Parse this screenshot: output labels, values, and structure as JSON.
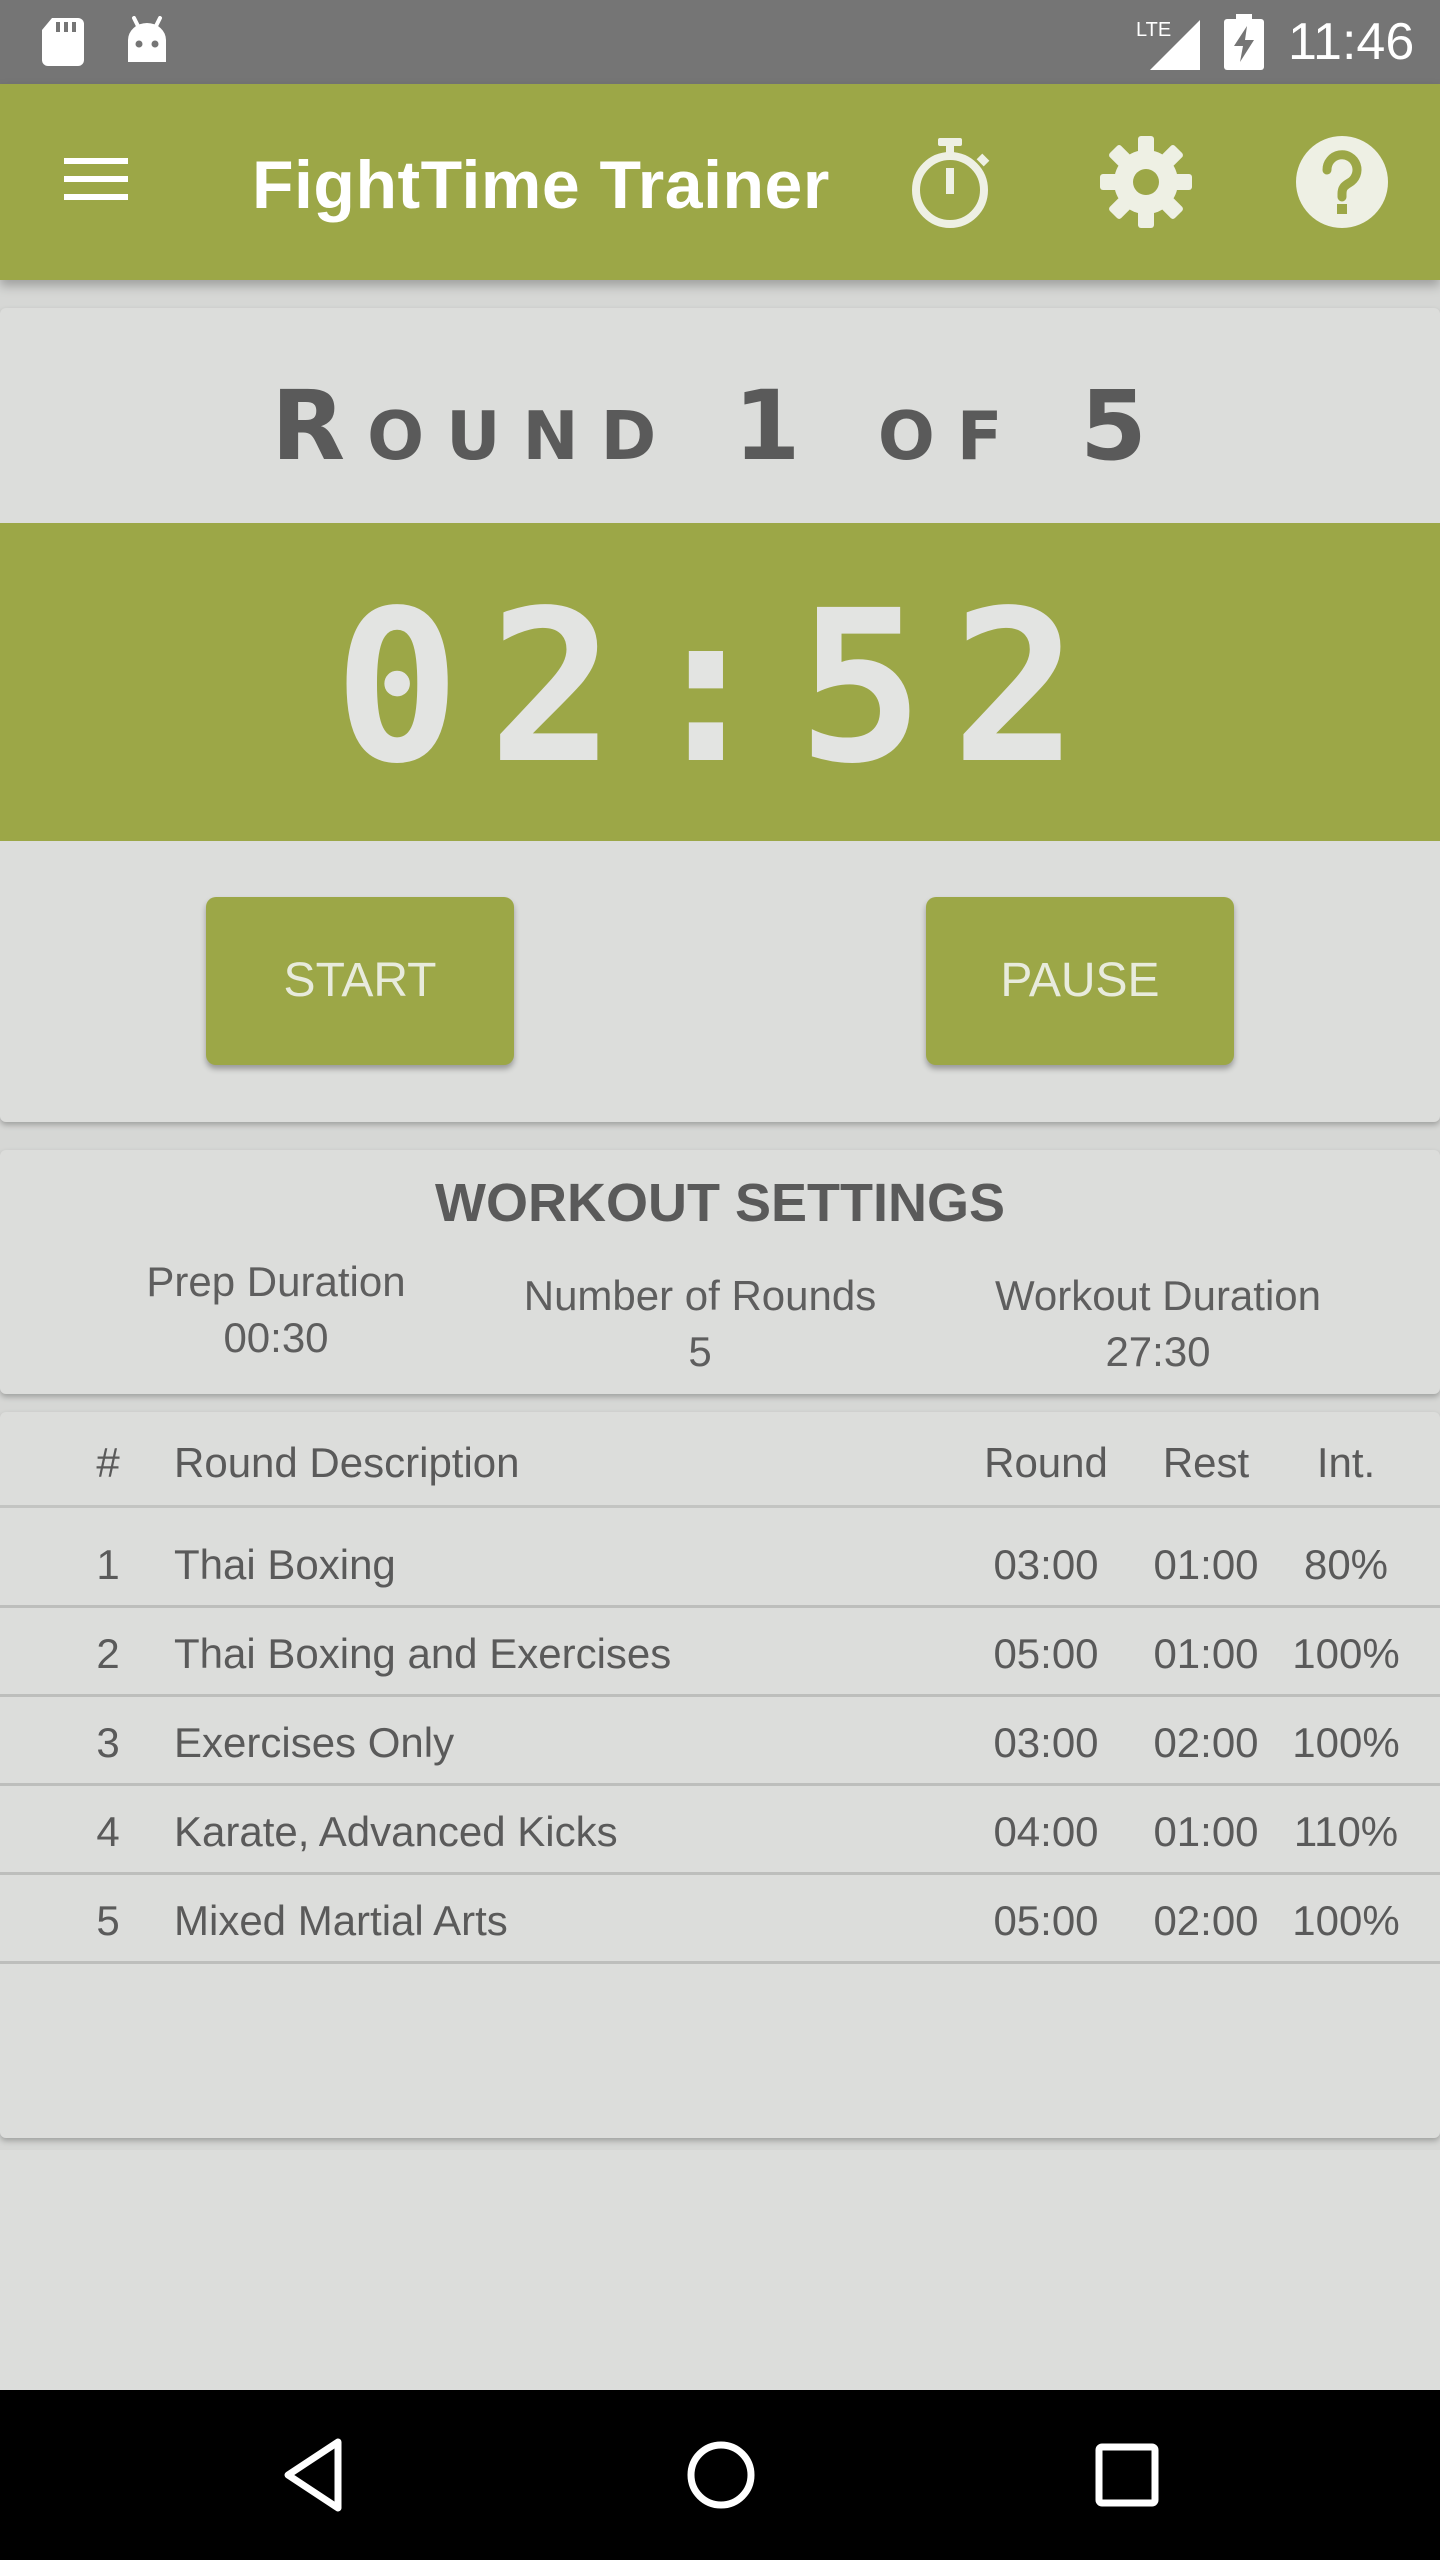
{
  "status_bar": {
    "time": "11:46",
    "network": "LTE",
    "icons": [
      "sd-card-icon",
      "android-icon",
      "lte-signal-icon",
      "battery-charging-icon"
    ]
  },
  "app_bar": {
    "title": "FightTime Trainer",
    "icons": [
      "menu-icon",
      "stopwatch-icon",
      "gear-icon",
      "help-icon"
    ],
    "color": "#9ca747"
  },
  "timer": {
    "round_label": "Round 1 of 5",
    "time": "02:52",
    "start_label": "START",
    "pause_label": "PAUSE"
  },
  "settings": {
    "title": "WORKOUT SETTINGS",
    "prep_label": "Prep Duration",
    "prep_value": "00:30",
    "rounds_label": "Number of Rounds",
    "rounds_value": "5",
    "duration_label": "Workout Duration",
    "duration_value": "27:30"
  },
  "rounds_table": {
    "headers": {
      "num": "#",
      "desc": "Round Description",
      "round": "Round",
      "rest": "Rest",
      "int": "Int."
    },
    "rows": [
      {
        "num": "1",
        "desc": "Thai Boxing",
        "round": "03:00",
        "rest": "01:00",
        "int": "80%"
      },
      {
        "num": "2",
        "desc": "Thai Boxing and Exercises",
        "round": "05:00",
        "rest": "01:00",
        "int": "100%"
      },
      {
        "num": "3",
        "desc": "Exercises Only",
        "round": "03:00",
        "rest": "02:00",
        "int": "100%"
      },
      {
        "num": "4",
        "desc": "Karate, Advanced Kicks",
        "round": "04:00",
        "rest": "01:00",
        "int": "110%"
      },
      {
        "num": "5",
        "desc": "Mixed Martial Arts",
        "round": "05:00",
        "rest": "02:00",
        "int": "100%"
      }
    ]
  },
  "nav_bar": {
    "icons": [
      "back-icon",
      "home-icon",
      "recents-icon"
    ]
  }
}
